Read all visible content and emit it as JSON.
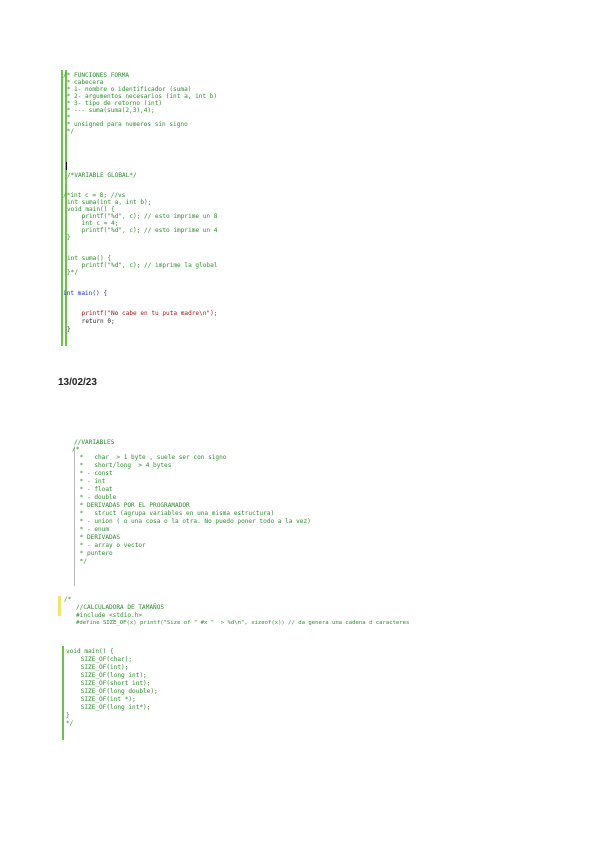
{
  "block1": {
    "lines": [
      "/* FUNCIONES FORMA",
      " * cabecera",
      " * 1- nombre o identificador (suma)",
      " * 2- argumentos necesarios (int a, int b)",
      " * 3- tipo de retorno (int)",
      " * --- suma(suma(2,3),4);",
      " *",
      " * unsigned para numeros sin signo",
      " */",
      "",
      "",
      "/*VARIABLE GLOBAL*/",
      "",
      "/*int c = 8; //vs",
      "int suma(int a, int b);",
      "void main() {",
      "    printf(\"%d\", c); // esto imprime un 8",
      "    int c = 4;",
      "    printf(\"%d\", c); // esto imprime un 4",
      "}",
      "",
      "int suma() {",
      "    printf(\"%d\", c); // imprime la global",
      "}*/",
      "",
      "int main() {",
      "",
      "    printf(\"No cabe en tu puta madre\\n\");",
      "    return 0;",
      "}"
    ]
  },
  "date": "13/02/23",
  "block2": {
    "lines": [
      "//VARIABLES",
      "/*",
      " *   char  > 1 byte , suele ser con signo",
      " *   short/long  > 4 bytes",
      " * - const",
      " * - int",
      " * - float",
      " * - double",
      " * DERIVADAS POR EL PROGRAMADOR",
      " *   struct (agrupa variables en una misma estructura)",
      " * - union ( o una cosa o la otra. No puedo poner todo a la vez)",
      " * - enum",
      " * DERIVADAS",
      " * - array o vector",
      " * puntero",
      " */"
    ]
  },
  "block3": {
    "lines": [
      "/*",
      "//CALCULADORA DE TAMAÑOS",
      "#include <stdio.h>",
      "#define SIZE_OF(x) printf(\"Size of \" #x \"  > %d\\n\", sizeof(x)) // da genera una cadena d caracteres"
    ]
  },
  "block4": {
    "lines": [
      "void main() {",
      "    SIZE_OF(char);",
      "    SIZE_OF(int);",
      "    SIZE_OF(long int);",
      "    SIZE_OF(short int);",
      "    SIZE_OF(long double);",
      "    SIZE_OF(int *);",
      "    SIZE_OF(long int*);",
      "}",
      "*/"
    ]
  }
}
